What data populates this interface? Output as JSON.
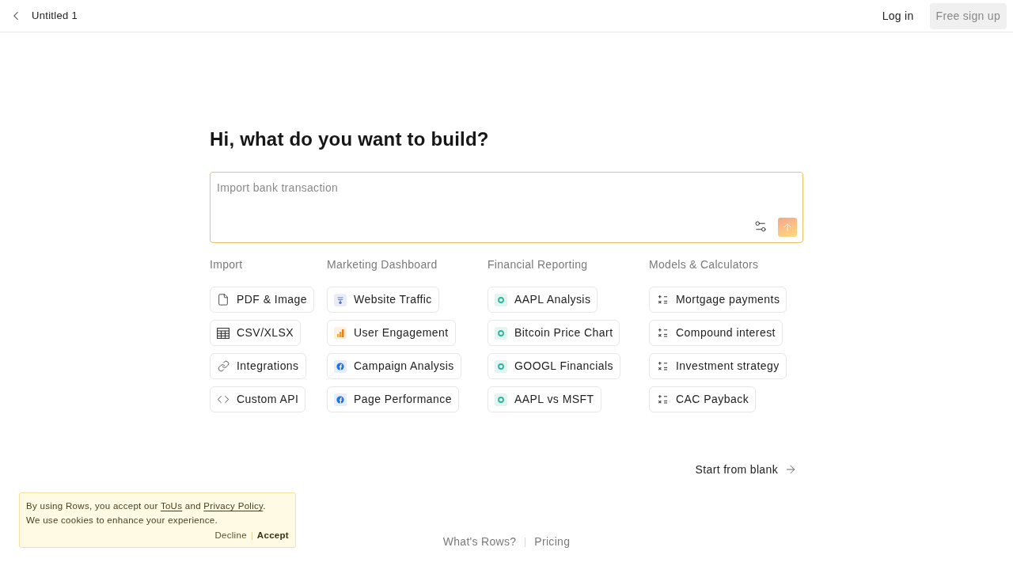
{
  "header": {
    "title": "Untitled 1",
    "login": "Log in",
    "signup": {
      "label": "Free sign up",
      "disabled": true
    }
  },
  "prompt": {
    "heading": "Hi, what do you want to build?",
    "placeholder": "Import bank transaction"
  },
  "categories": [
    {
      "title": "Import",
      "items": [
        {
          "label": "PDF & Image",
          "kind": "document"
        },
        {
          "label": "CSV/XLSX",
          "kind": "table"
        },
        {
          "label": "Integrations",
          "kind": "link"
        },
        {
          "label": "Custom API",
          "kind": "code"
        }
      ]
    },
    {
      "title": "Marketing Dashboard",
      "items": [
        {
          "label": "Website Traffic",
          "kind": "traffic"
        },
        {
          "label": "User Engagement",
          "kind": "analytics"
        },
        {
          "label": "Campaign Analysis",
          "kind": "social"
        },
        {
          "label": "Page Performance",
          "kind": "social"
        }
      ]
    },
    {
      "title": "Financial Reporting",
      "items": [
        {
          "label": "AAPL Analysis",
          "kind": "stock"
        },
        {
          "label": "Bitcoin Price Chart",
          "kind": "stock"
        },
        {
          "label": "GOOGL Financials",
          "kind": "stock"
        },
        {
          "label": "AAPL vs MSFT",
          "kind": "stock"
        }
      ]
    },
    {
      "title": "Models & Calculators",
      "items": [
        {
          "label": "Mortgage payments",
          "kind": "calculator"
        },
        {
          "label": "Compound interest",
          "kind": "calculator"
        },
        {
          "label": "Investment strategy",
          "kind": "calculator"
        },
        {
          "label": "CAC Payback",
          "kind": "calculator"
        }
      ]
    }
  ],
  "start_blank": "Start from blank",
  "cookie_banner": {
    "notice": [
      {
        "kind": "text",
        "text": "By using Rows, you accept our "
      },
      {
        "kind": "link",
        "text": "ToUs"
      },
      {
        "kind": "text",
        "text": " and "
      },
      {
        "kind": "link",
        "text": "Privacy Policy"
      },
      {
        "kind": "text",
        "text": "."
      }
    ],
    "note": "We use cookies to enhance your experience.",
    "decline": "Decline",
    "accept": "Accept"
  },
  "footer_links": [
    "What's Rows?",
    "Pricing"
  ]
}
